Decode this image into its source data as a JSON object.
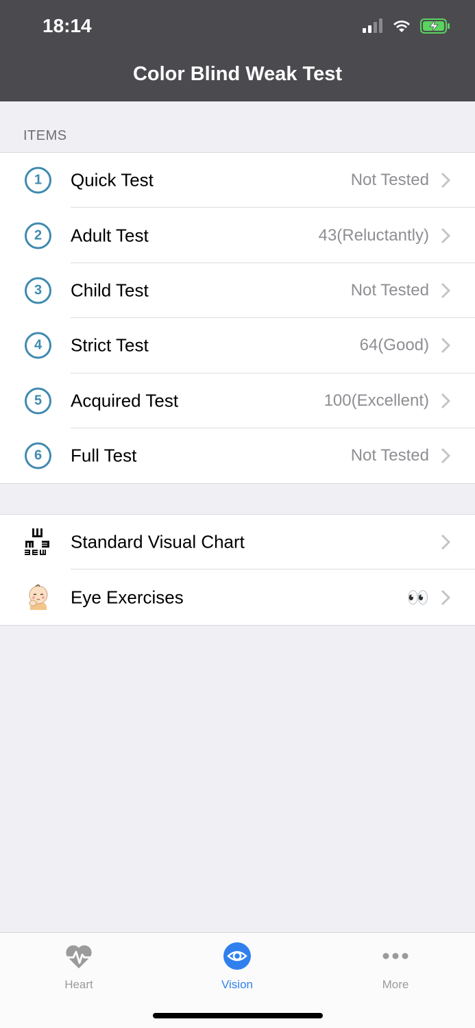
{
  "status_bar": {
    "time": "18:14"
  },
  "nav": {
    "title": "Color Blind Weak Test"
  },
  "items_section": {
    "header": "ITEMS",
    "rows": [
      {
        "number": "1",
        "label": "Quick Test",
        "detail": "Not Tested"
      },
      {
        "number": "2",
        "label": "Adult Test",
        "detail": "43(Reluctantly)"
      },
      {
        "number": "3",
        "label": "Child Test",
        "detail": "Not Tested"
      },
      {
        "number": "4",
        "label": "Strict Test",
        "detail": "64(Good)"
      },
      {
        "number": "5",
        "label": "Acquired Test",
        "detail": "100(Excellent)"
      },
      {
        "number": "6",
        "label": "Full Test",
        "detail": "Not Tested"
      }
    ]
  },
  "extras_section": {
    "rows": [
      {
        "label": "Standard Visual Chart",
        "icon": "eye-chart-icon"
      },
      {
        "label": "Eye Exercises",
        "icon": "baby-face-icon",
        "detail": "👀"
      }
    ]
  },
  "tabbar": {
    "tabs": [
      {
        "label": "Heart",
        "icon": "heart-pulse-icon",
        "active": false
      },
      {
        "label": "Vision",
        "icon": "eye-icon",
        "active": true
      },
      {
        "label": "More",
        "icon": "more-dots-icon",
        "active": false
      }
    ]
  },
  "colors": {
    "nav_bg": "#4b4b4f",
    "accent": "#3f8ab0",
    "tab_active": "#2f80ed",
    "tab_inactive": "#9b9b9b",
    "battery": "#5bd35f"
  }
}
